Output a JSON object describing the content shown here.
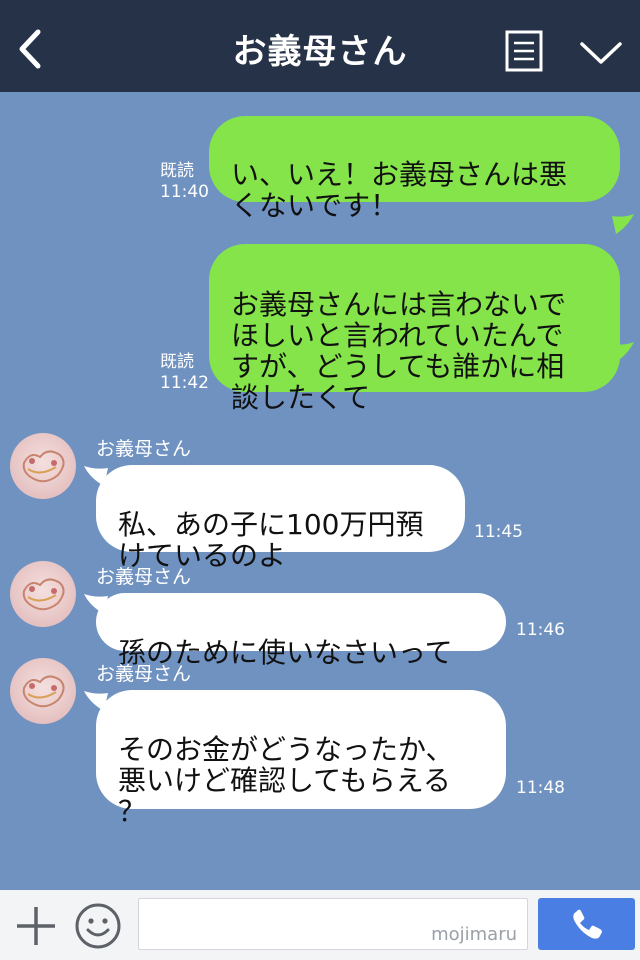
{
  "header": {
    "title": "お義母さん"
  },
  "messages": [
    {
      "read_label": "既読",
      "time": "11:40",
      "text": "い、いえ！お義母さんは悪\nくないです！"
    },
    {
      "read_label": "既読",
      "time": "11:42",
      "text": "お義母さんには言わないで\nほしいと言われていたんで\nすが、どうしても誰かに相\n談したくて"
    },
    {
      "sender": "お義母さん",
      "time": "11:45",
      "text": "私、あの子に100万円預\nけているのよ"
    },
    {
      "sender": "お義母さん",
      "time": "11:46",
      "text": "孫のために使いなさいって"
    },
    {
      "sender": "お義母さん",
      "time": "11:48",
      "text": "そのお金がどうなったか、\n悪いけど確認してもらえる\n？"
    }
  ],
  "input": {
    "watermark": "mojimaru"
  },
  "colors": {
    "header_bg": "#263247",
    "chat_bg": "#6f92c1",
    "outgoing_bubble": "#84e449",
    "incoming_bubble": "#ffffff",
    "call_button": "#4b7ee2"
  },
  "icons": [
    "back-chevron-icon",
    "menu-icon",
    "collapse-chevron-icon",
    "plus-icon",
    "smiley-icon",
    "phone-icon"
  ]
}
